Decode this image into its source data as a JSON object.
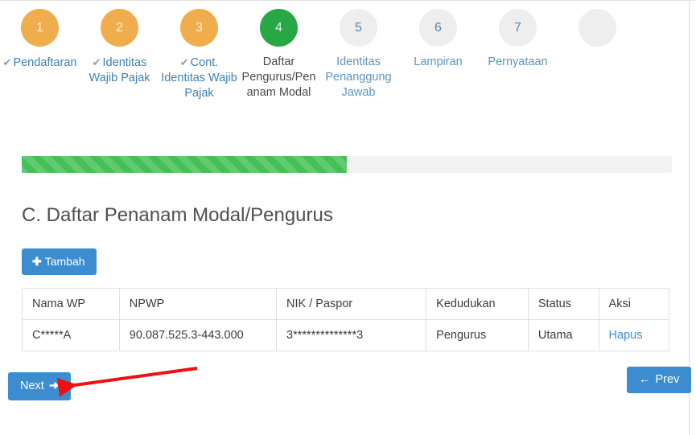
{
  "wizard": {
    "steps": [
      {
        "number": "1",
        "label": "Pendaftaran",
        "state": "done",
        "check": "✔"
      },
      {
        "number": "2",
        "label": "Identitas Wajib Pajak",
        "state": "done",
        "check": "✔"
      },
      {
        "number": "3",
        "label": "Cont. Identitas Wajib Pajak",
        "state": "done",
        "check": "✔"
      },
      {
        "number": "4",
        "label": "Daftar Pengurus/Penanam Modal",
        "state": "current",
        "check": ""
      },
      {
        "number": "5",
        "label": "Identitas Penanggung Jawab",
        "state": "todo",
        "check": ""
      },
      {
        "number": "6",
        "label": "Lampiran",
        "state": "todo",
        "check": ""
      },
      {
        "number": "7",
        "label": "Pernyataan",
        "state": "todo",
        "check": ""
      },
      {
        "number": "",
        "label": "",
        "state": "todo",
        "check": ""
      }
    ]
  },
  "progress": {
    "percent": 50,
    "fill_color": "#45c059",
    "track_color": "#f3f3f3"
  },
  "section": {
    "title": "C. Daftar Penanam Modal/Pengurus"
  },
  "toolbar": {
    "add_plus": "✚",
    "add_label": "Tambah"
  },
  "table": {
    "headers": [
      "Nama WP",
      "NPWP",
      "NIK / Paspor",
      "Kedudukan",
      "Status",
      "Aksi"
    ],
    "rows": [
      {
        "nama_wp": "C*****A",
        "npwp": "90.087.525.3-443.000",
        "nik_paspor": "3**************3",
        "kedudukan": "Pengurus",
        "status": "Utama",
        "aksi": "Hapus"
      }
    ]
  },
  "footer": {
    "next_label": "Next",
    "next_arrow": "➜",
    "prev_label": "Prev",
    "prev_arrow": "←"
  },
  "annotation": {
    "color": "#ee1111"
  },
  "colors": {
    "primary_blue": "#3b8dd0",
    "step_done": "#f0ad4e",
    "step_current": "#28a745",
    "step_todo": "#eeeeee"
  }
}
